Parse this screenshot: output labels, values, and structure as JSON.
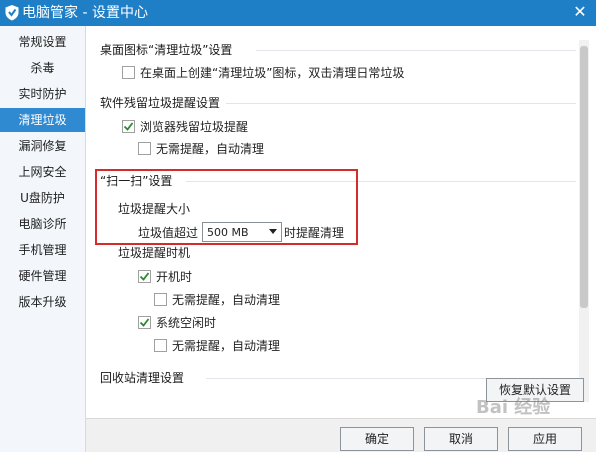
{
  "window": {
    "title": "电脑管家 - 设置中心",
    "close_label": "✕"
  },
  "sidebar": {
    "items": [
      {
        "label": "常规设置"
      },
      {
        "label": "杀毒"
      },
      {
        "label": "实时防护"
      },
      {
        "label": "清理垃圾"
      },
      {
        "label": "漏洞修复"
      },
      {
        "label": "上网安全"
      },
      {
        "label": "U盘防护"
      },
      {
        "label": "电脑诊所"
      },
      {
        "label": "手机管理"
      },
      {
        "label": "硬件管理"
      },
      {
        "label": "版本升级"
      }
    ],
    "active_index": 3
  },
  "content": {
    "desktop_section": {
      "title": "桌面图标“清理垃圾”设置",
      "create_icon": {
        "label": "在桌面上创建“清理垃圾”图标，双击清理日常垃圾",
        "checked": false
      }
    },
    "residue_section": {
      "title": "软件残留垃圾提醒设置",
      "browser_residue": {
        "label": "浏览器残留垃圾提醒",
        "checked": true
      },
      "no_remind_auto": {
        "label": "无需提醒，自动清理",
        "checked": false
      }
    },
    "scan_section": {
      "title": "“扫一扫”设置",
      "size_title": "垃圾提醒大小",
      "size_prefix": "垃圾值超过",
      "size_value": "500 MB",
      "size_suffix": "时提醒清理",
      "timing_title": "垃圾提醒时机",
      "on_boot": {
        "label": "开机时",
        "checked": true
      },
      "on_boot_auto": {
        "label": "无需提醒，自动清理",
        "checked": false
      },
      "on_idle": {
        "label": "系统空闲时",
        "checked": true
      },
      "on_idle_auto": {
        "label": "无需提醒，自动清理",
        "checked": false
      }
    },
    "recycle_section": {
      "title": "回收站清理设置"
    },
    "restore_label": "恢复默认设置"
  },
  "footer": {
    "ok_label": "确定",
    "cancel_label": "取消",
    "apply_label": "应用"
  },
  "watermark": "Bai 经验",
  "colors": {
    "titlebar": "#1f7fc6",
    "active_nav": "#2f8ad1",
    "highlight_box": "#d52b2b"
  }
}
